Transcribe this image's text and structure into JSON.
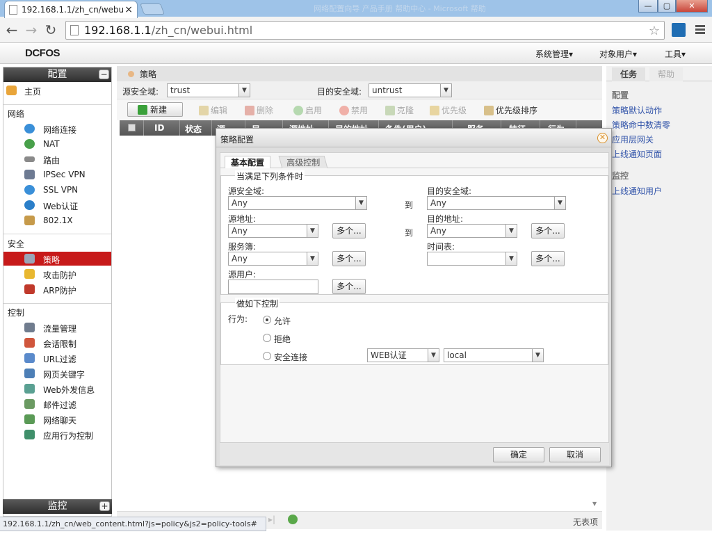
{
  "browser": {
    "tab_title": "192.168.1.1/zh_cn/webu",
    "tab_close": "×",
    "window_title": "网络配置向导 产品手册 帮助中心 - Microsoft 帮助",
    "url_host": "192.168.1.1",
    "url_path": "/zh_cn/webui.html",
    "status_url": "192.168.1.1/zh_cn/web_content.html?js=policy&js2=policy-tools#"
  },
  "app": {
    "logo": "DCFOS",
    "menus": [
      "系统管理▾",
      "对象用户▾",
      "工具▾"
    ]
  },
  "sidebar": {
    "config_title": "配置",
    "config_toggle": "−",
    "home": "主页",
    "network_section": "网络",
    "network_items": [
      "网络连接",
      "NAT",
      "路由",
      "IPSec VPN",
      "SSL VPN",
      "Web认证",
      "802.1X"
    ],
    "security_section": "安全",
    "security_items": [
      "策略",
      "攻击防护",
      "ARP防护"
    ],
    "control_section": "控制",
    "control_items": [
      "流量管理",
      "会话限制",
      "URL过滤",
      "网页关键字",
      "Web外发信息",
      "邮件过滤",
      "网络聊天",
      "应用行为控制"
    ],
    "monitor_title": "监控",
    "monitor_toggle": "+"
  },
  "main": {
    "breadcrumb": "策略",
    "src_zone_label": "源安全域:",
    "src_zone_value": "trust",
    "dst_zone_label": "目的安全域:",
    "dst_zone_value": "untrust",
    "actions": {
      "new": "新建",
      "edit": "编辑",
      "delete": "删除",
      "enable": "启用",
      "disable": "禁用",
      "clone": "克隆",
      "priority": "优先级",
      "priority_sort": "优先级排序"
    },
    "columns": [
      "ID",
      "状态",
      "源",
      "目",
      "源地址",
      "目的地址",
      "条件(用户)",
      "服务",
      "特征",
      "行为"
    ],
    "no_records": "无表项"
  },
  "right_panel": {
    "tabs": [
      "任务",
      "帮助"
    ],
    "config_head": "配置",
    "config_links": [
      "策略默认动作",
      "策略命中数清零",
      "应用层网关",
      "上线通知页面"
    ],
    "monitor_head": "监控",
    "monitor_links": [
      "上线通知用户"
    ]
  },
  "dialog": {
    "title": "策略配置",
    "close": "✕",
    "tabs": [
      "基本配置",
      "高级控制"
    ],
    "conditions_legend": "当满足下列条件时",
    "src_zone_label": "源安全域:",
    "src_zone_value": "Any",
    "to1": "到",
    "dst_zone_label": "目的安全域:",
    "dst_zone_value": "Any",
    "src_addr_label": "源地址:",
    "src_addr_value": "Any",
    "multi": "多个...",
    "to2": "到",
    "dst_addr_label": "目的地址:",
    "dst_addr_value": "Any",
    "service_label": "服务簿:",
    "service_value": "Any",
    "schedule_label": "时间表:",
    "schedule_value": "",
    "src_user_label": "源用户:",
    "control_legend": "做如下控制",
    "action_label": "行为:",
    "actions": [
      "允许",
      "拒绝",
      "安全连接"
    ],
    "selected_action": "允许",
    "auth_value": "WEB认证",
    "local_value": "local",
    "ok": "确定",
    "cancel": "取消"
  }
}
